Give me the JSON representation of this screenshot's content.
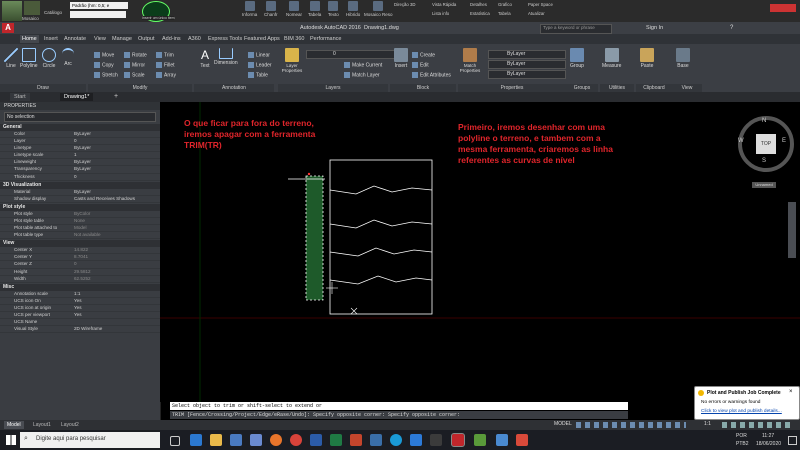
{
  "plugin_bar": {
    "style_value": "Padrão (hm: 0,5; e",
    "catalog_label": "Catálogo",
    "mosaic_label": "Mosaico",
    "drawing_tool_label": "Inserir um único item",
    "buttons": [
      "Informa",
      "Chanfr",
      "Nomear",
      "Tabela",
      "Texto",
      "Hibrido",
      "Mosaico Reso"
    ],
    "right_items": [
      "Direção 3D",
      "Vista Rápida",
      "Detalhes",
      "Grafico",
      "Paper Space",
      "Lista info",
      "Estatística",
      "Tabela",
      "Atualizar"
    ]
  },
  "title": {
    "app": "Autodesk AutoCAD 2016",
    "file": "Drawing1.dwg",
    "search_placeholder": "Type a keyword or phrase",
    "sign_in": "Sign In"
  },
  "ribbon_tabs": [
    "Home",
    "Insert",
    "Annotate",
    "View",
    "Manage",
    "Output",
    "Add-ins",
    "A360",
    "Express Tools",
    "Featured Apps",
    "BIM 360",
    "Performance"
  ],
  "ribbon": {
    "draw": {
      "title": "Draw",
      "line": "Line",
      "polyline": "Polyline",
      "circle": "Circle",
      "arc": "Arc"
    },
    "modify": {
      "title": "Modify",
      "move": "Move",
      "rotate": "Rotate",
      "trim": "Trim",
      "copy": "Copy",
      "mirror": "Mirror",
      "fillet": "Fillet",
      "stretch": "Stretch",
      "scale": "Scale",
      "array": "Array"
    },
    "annotation": {
      "title": "Annotation",
      "text": "Text",
      "dimension": "Dimension",
      "linear": "Linear",
      "leader": "Leader",
      "table": "Table"
    },
    "layers": {
      "title": "Layers",
      "layer_properties": "Layer Properties",
      "make_current": "Make Current",
      "match_layer": "Match Layer",
      "layer_value": "0"
    },
    "block": {
      "title": "Block",
      "insert": "Insert",
      "create": "Create",
      "edit": "Edit",
      "edit_attributes": "Edit Attributes"
    },
    "properties": {
      "title": "Properties",
      "match_properties": "Match Properties",
      "bylayer1": "ByLayer",
      "bylayer2": "ByLayer",
      "bylayer3": "ByLayer"
    },
    "groups": {
      "title": "Groups",
      "group": "Group"
    },
    "utilities": {
      "title": "Utilities",
      "measure": "Measure"
    },
    "clipboard": {
      "title": "Clipboard",
      "paste": "Paste"
    },
    "view": {
      "title": "View",
      "base": "Base"
    }
  },
  "file_tabs": {
    "start": "Start",
    "drawing": "Drawing1*"
  },
  "properties_panel": {
    "title": "PROPERTIES",
    "selection": "No selection",
    "sections": [
      {
        "name": "General",
        "rows": [
          [
            "Color",
            "ByLayer"
          ],
          [
            "Layer",
            "0"
          ],
          [
            "Linetype",
            "ByLayer"
          ],
          [
            "Linetype scale",
            "1"
          ],
          [
            "Lineweight",
            "ByLayer"
          ],
          [
            "Transparency",
            "ByLayer"
          ],
          [
            "Thickness",
            "0"
          ]
        ]
      },
      {
        "name": "3D Visualization",
        "rows": [
          [
            "Material",
            "ByLayer"
          ],
          [
            "Shadow display",
            "Casts and Receives Shadows"
          ]
        ]
      },
      {
        "name": "Plot style",
        "rows": [
          [
            "Plot style",
            "ByColor"
          ],
          [
            "Plot style table",
            "None"
          ],
          [
            "Plot table attached to",
            "Model"
          ],
          [
            "Plot table type",
            "Not available"
          ]
        ]
      },
      {
        "name": "View",
        "rows": [
          [
            "Center X",
            "14.822"
          ],
          [
            "Center Y",
            "8.7041"
          ],
          [
            "Center Z",
            "0"
          ],
          [
            "Height",
            "29.5812"
          ],
          [
            "Width",
            "62.5252"
          ]
        ]
      },
      {
        "name": "Misc",
        "rows": [
          [
            "Annotation scale",
            "1:1"
          ],
          [
            "UCS icon On",
            "Yes"
          ],
          [
            "UCS icon at origin",
            "Yes"
          ],
          [
            "UCS per viewport",
            "Yes"
          ],
          [
            "UCS Name",
            ""
          ],
          [
            "Visual Style",
            "2D Wireframe"
          ]
        ]
      }
    ]
  },
  "annotations": {
    "left": [
      "O que ficar para fora do terreno,",
      "iremos apagar com a ferramenta",
      "TRIM(TR)"
    ],
    "right": [
      "Primeiro, iremos desenhar com uma",
      "polyline o terreno, e tambem com a",
      "mesma ferramenta, criaremos as linha",
      "referentes as curvas de nível"
    ]
  },
  "viewcube": {
    "top": "TOP",
    "n": "N",
    "s": "S",
    "e": "E",
    "w": "W",
    "wcs": "Unnamed"
  },
  "command": {
    "prompt1": "Select object to trim or shift-select to extend or",
    "prompt2": "TRIM [Fence/Crossing/Project/Edge/eRase/Undo]: Specify opposite corner: Specify opposite corner:"
  },
  "layout_tabs": [
    "Model",
    "Layout1",
    "Layout2"
  ],
  "status": {
    "model": "MODEL",
    "scale": "1:1"
  },
  "notification": {
    "title": "Plot and Publish Job Complete",
    "line1": "No errors or warnings found",
    "link": "Click to view plot and publish details..."
  },
  "taskbar": {
    "search_placeholder": "Digite aqui para pesquisar",
    "lang": "POR",
    "layout": "PTB2",
    "time": "11:27",
    "date": "18/06/2020"
  },
  "colors": {
    "annotation": "#e0252b",
    "hatch": "#1e5a2a",
    "ribbon": "#3b3e44"
  }
}
